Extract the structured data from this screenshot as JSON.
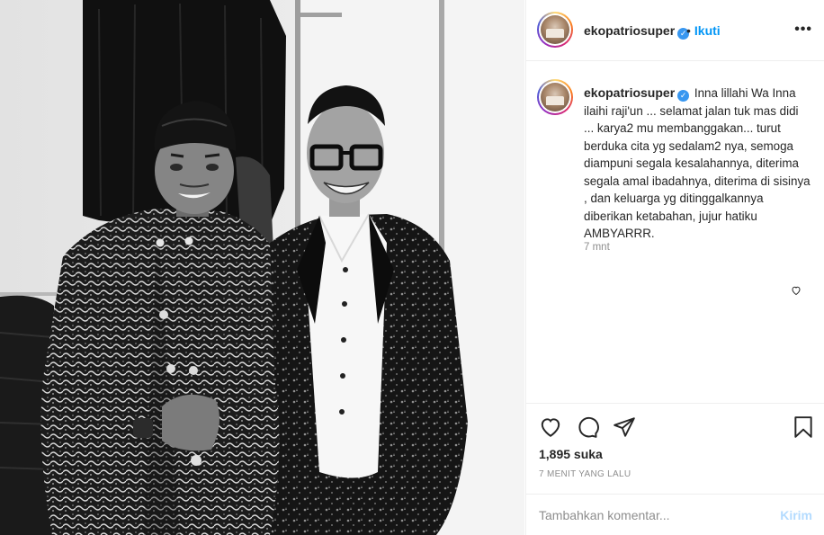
{
  "post": {
    "username": "ekopatriosuper",
    "follow_label": "Ikuti",
    "dot": "•",
    "more": "•••",
    "caption": "Inna lillahi Wa Inna ilaihi raji'un ... selamat jalan tuk mas didi ... karya2 mu membanggakan... turut berduka cita yg sedalam2 nya, semoga diampuni segala kesalahannya, diterima segala amal ibadahnya, diterima di sisinya , dan keluarga yg ditinggalkannya diberikan ketabahan, jujur hatiku AMBYARRR.",
    "comment_time": "7 mnt",
    "likes": "1,895 suka",
    "posted": "7 MENIT YANG LALU",
    "comment_placeholder": "Tambahkan komentar...",
    "post_button": "Kirim"
  },
  "icons": {
    "verified": "verified-badge-icon",
    "like": "heart-icon",
    "comment": "comment-icon",
    "share": "paper-plane-icon",
    "save": "bookmark-icon",
    "more": "more-options-icon"
  },
  "colors": {
    "link": "#0095f6",
    "verified": "#3897f0",
    "muted": "#8e8e8e",
    "border": "#efefef",
    "post_button_disabled": "#b3dbff"
  }
}
